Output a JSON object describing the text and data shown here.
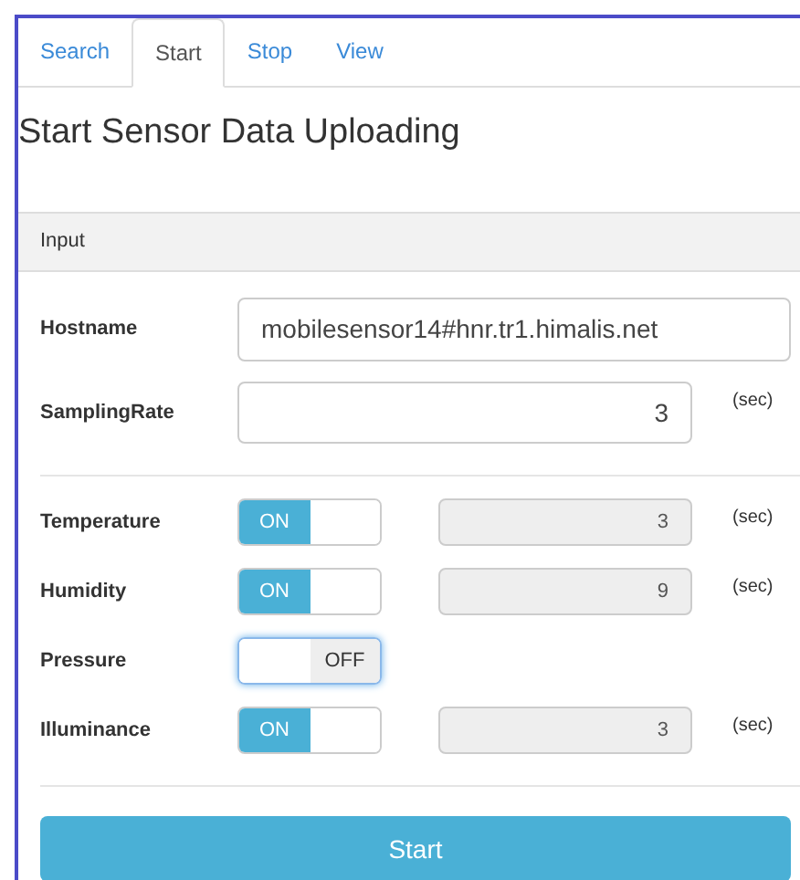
{
  "tabs": [
    {
      "label": "Search",
      "selected": false
    },
    {
      "label": "Start",
      "selected": true
    },
    {
      "label": "Stop",
      "selected": false
    },
    {
      "label": "View",
      "selected": false
    }
  ],
  "title": "Start Sensor Data Uploading",
  "panel_heading": "Input",
  "hostname": {
    "label": "Hostname",
    "value": "mobilesensor14#hnr.tr1.himalis.net"
  },
  "sampling_rate": {
    "label": "SamplingRate",
    "value": "3",
    "unit": "(sec)"
  },
  "sensors": [
    {
      "name": "Temperature",
      "toggle_label": "ON",
      "on": true,
      "interval": "3",
      "unit": "(sec)"
    },
    {
      "name": "Humidity",
      "toggle_label": "ON",
      "on": true,
      "interval": "9",
      "unit": "(sec)"
    },
    {
      "name": "Pressure",
      "toggle_label": "OFF",
      "on": false
    },
    {
      "name": "Illuminance",
      "toggle_label": "ON",
      "on": true,
      "interval": "3",
      "unit": "(sec)"
    }
  ],
  "button": "Start"
}
